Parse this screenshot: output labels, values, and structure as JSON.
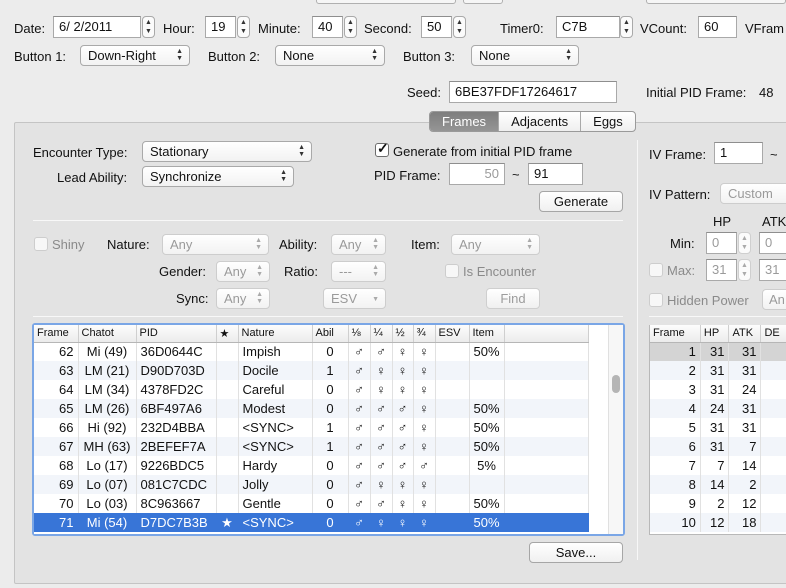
{
  "top": {
    "date_label": "Date:",
    "date_value": "6/ 2/2011",
    "hour_label": "Hour:",
    "hour_value": "19",
    "minute_label": "Minute:",
    "minute_value": "40",
    "second_label": "Second:",
    "second_value": "50",
    "timer0_label": "Timer0:",
    "timer0_value": "C7B",
    "vcount_label": "VCount:",
    "vcount_value": "60",
    "vframe_label": "VFram",
    "button1_label": "Button 1:",
    "button1_value": "Down-Right",
    "button2_label": "Button 2:",
    "button2_value": "None",
    "button3_label": "Button 3:",
    "button3_value": "None",
    "seed_label": "Seed:",
    "seed_value": "6BE37FDF17264617",
    "initial_pid_frame_label": "Initial PID Frame:",
    "initial_pid_frame_value": "48"
  },
  "tabs": [
    "Frames",
    "Adjacents",
    "Eggs"
  ],
  "frames": {
    "encounter_type_label": "Encounter Type:",
    "encounter_type_value": "Stationary",
    "lead_ability_label": "Lead Ability:",
    "lead_ability_value": "Synchronize",
    "gen_from_initial_label": "Generate from initial PID frame",
    "pid_frame_label": "PID Frame:",
    "pid_frame_from": "50",
    "pid_frame_tilde": "~",
    "pid_frame_to": "91",
    "generate_button": "Generate",
    "shiny_label": "Shiny",
    "nature_label": "Nature:",
    "nature_value": "Any",
    "ability_label": "Ability:",
    "ability_value": "Any",
    "item_label": "Item:",
    "item_value": "Any",
    "gender_label": "Gender:",
    "gender_value": "Any",
    "ratio_label": "Ratio:",
    "ratio_value": "---",
    "is_encounter_label": "Is Encounter",
    "sync_label": "Sync:",
    "sync_value": "Any",
    "esv_value": "ESV",
    "find_button": "Find",
    "save_button": "Save..."
  },
  "results_table": {
    "columns": [
      "Frame",
      "Chatot",
      "PID",
      "★",
      "Nature",
      "Abil",
      "⅛",
      "¼",
      "½",
      "¾",
      "ESV",
      "Item"
    ],
    "rows": [
      {
        "frame": "62",
        "chatot": "Mi (49)",
        "pid": "36D0644C",
        "star": "",
        "nature": "Impish",
        "abil": "0",
        "g1": "♂",
        "g2": "♂",
        "g3": "♀",
        "g4": "♀",
        "esv": "",
        "item": "50%"
      },
      {
        "frame": "63",
        "chatot": "LM (21)",
        "pid": "D90D703D",
        "star": "",
        "nature": "Docile",
        "abil": "1",
        "g1": "♂",
        "g2": "♀",
        "g3": "♀",
        "g4": "♀",
        "esv": "",
        "item": ""
      },
      {
        "frame": "64",
        "chatot": "LM (34)",
        "pid": "4378FD2C",
        "star": "",
        "nature": "Careful",
        "abil": "0",
        "g1": "♂",
        "g2": "♀",
        "g3": "♀",
        "g4": "♀",
        "esv": "",
        "item": ""
      },
      {
        "frame": "65",
        "chatot": "LM (26)",
        "pid": "6BF497A6",
        "star": "",
        "nature": "Modest",
        "abil": "0",
        "g1": "♂",
        "g2": "♂",
        "g3": "♂",
        "g4": "♀",
        "esv": "",
        "item": "50%"
      },
      {
        "frame": "66",
        "chatot": "Hi (92)",
        "pid": "232D4BBA",
        "star": "",
        "nature": "<SYNC>",
        "abil": "1",
        "g1": "♂",
        "g2": "♂",
        "g3": "♂",
        "g4": "♀",
        "esv": "",
        "item": "50%"
      },
      {
        "frame": "67",
        "chatot": "MH (63)",
        "pid": "2BEFEF7A",
        "star": "",
        "nature": "<SYNC>",
        "abil": "1",
        "g1": "♂",
        "g2": "♂",
        "g3": "♂",
        "g4": "♀",
        "esv": "",
        "item": "50%"
      },
      {
        "frame": "68",
        "chatot": "Lo (17)",
        "pid": "9226BDC5",
        "star": "",
        "nature": "Hardy",
        "abil": "0",
        "g1": "♂",
        "g2": "♂",
        "g3": "♂",
        "g4": "♂",
        "esv": "",
        "item": "5%"
      },
      {
        "frame": "69",
        "chatot": "Lo (07)",
        "pid": "081C7CDC",
        "star": "",
        "nature": "Jolly",
        "abil": "0",
        "g1": "♂",
        "g2": "♀",
        "g3": "♀",
        "g4": "♀",
        "esv": "",
        "item": ""
      },
      {
        "frame": "70",
        "chatot": "Lo (03)",
        "pid": "8C963667",
        "star": "",
        "nature": "Gentle",
        "abil": "0",
        "g1": "♂",
        "g2": "♂",
        "g3": "♀",
        "g4": "♀",
        "esv": "",
        "item": "50%"
      },
      {
        "frame": "71",
        "chatot": "Mi (54)",
        "pid": "D7DC7B3B",
        "star": "★",
        "nature": "<SYNC>",
        "abil": "0",
        "g1": "♂",
        "g2": "♀",
        "g3": "♀",
        "g4": "♀",
        "esv": "",
        "item": "50%"
      }
    ],
    "selected_row_index": 9
  },
  "right_panel": {
    "iv_frame_label": "IV Frame:",
    "iv_frame_value": "1",
    "iv_frame_tilde": "~",
    "iv_pattern_label": "IV Pattern:",
    "iv_pattern_value": "Custom",
    "hp_label": "HP",
    "atk_label": "ATK",
    "min_label": "Min:",
    "min_hp": "0",
    "min_atk": "0",
    "max_label": "Max:",
    "max_hp": "31",
    "max_atk": "31",
    "hidden_power_label": "Hidden Power",
    "hidden_power_value": "An"
  },
  "iv_table": {
    "columns": [
      "Frame",
      "HP",
      "ATK",
      "DE"
    ],
    "rows": [
      {
        "frame": "1",
        "hp": "31",
        "atk": "31",
        "de": ""
      },
      {
        "frame": "2",
        "hp": "31",
        "atk": "31",
        "de": ""
      },
      {
        "frame": "3",
        "hp": "31",
        "atk": "24",
        "de": ""
      },
      {
        "frame": "4",
        "hp": "24",
        "atk": "31",
        "de": ""
      },
      {
        "frame": "5",
        "hp": "31",
        "atk": "31",
        "de": ""
      },
      {
        "frame": "6",
        "hp": "31",
        "atk": "7",
        "de": ""
      },
      {
        "frame": "7",
        "hp": "7",
        "atk": "14",
        "de": ""
      },
      {
        "frame": "8",
        "hp": "14",
        "atk": "2",
        "de": ""
      },
      {
        "frame": "9",
        "hp": "2",
        "atk": "12",
        "de": ""
      },
      {
        "frame": "10",
        "hp": "12",
        "atk": "18",
        "de": ""
      }
    ]
  },
  "colors": {
    "selection": "#3875d7",
    "panel_bg": "#e3e3e3",
    "window_bg": "#ececec"
  },
  "icons": {
    "stepper": "stepper-arrows-icon",
    "popup": "popup-arrows-icon",
    "check": "checkmark-icon"
  }
}
